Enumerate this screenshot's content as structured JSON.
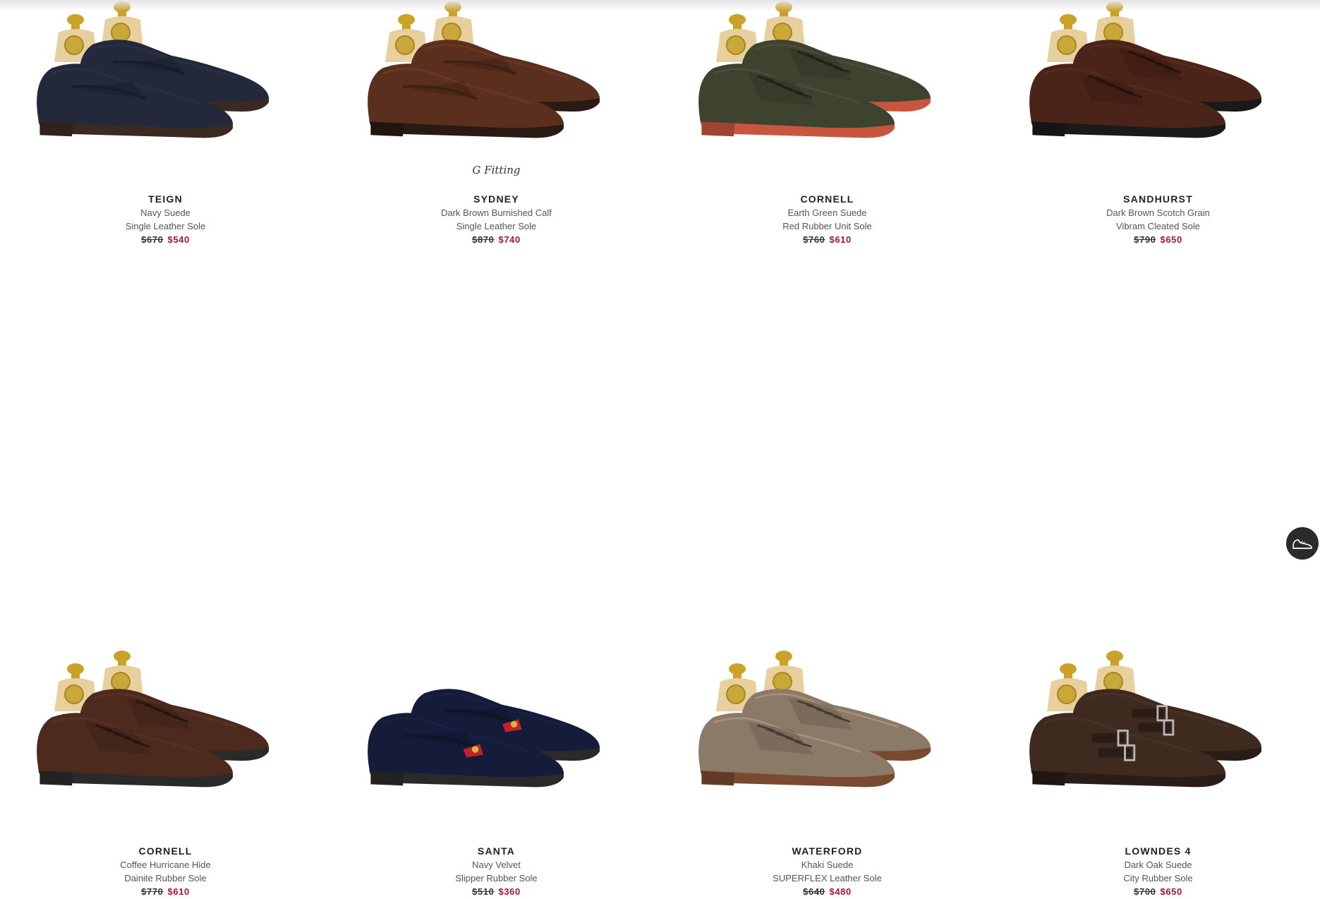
{
  "products": [
    {
      "name": "TEIGN",
      "material": "Navy Suede",
      "sole": "Single Leather Sole",
      "old_price": "$670",
      "new_price": "$540",
      "color": "#23283a",
      "sole_color": "#3b2a22",
      "style": "loafer"
    },
    {
      "name": "SYDNEY",
      "material": "Dark Brown Burnished Calf",
      "sole": "Single Leather Sole",
      "old_price": "$870",
      "new_price": "$740",
      "color": "#5a2f1e",
      "sole_color": "#2a1a14",
      "style": "loafer",
      "fitting": "G Fitting"
    },
    {
      "name": "CORNELL",
      "material": "Earth Green Suede",
      "sole": "Red Rubber Unit Sole",
      "old_price": "$760",
      "new_price": "$610",
      "color": "#3e4330",
      "sole_color": "#c8553d",
      "style": "derby"
    },
    {
      "name": "SANDHURST",
      "material": "Dark Brown Scotch Grain",
      "sole": "Vibram Cleated Sole",
      "old_price": "$790",
      "new_price": "$650",
      "color": "#4a2418",
      "sole_color": "#1a1a1a",
      "style": "derby"
    },
    {
      "name": "CORNELL",
      "material": "Coffee Hurricane Hide",
      "sole": "Dainite Rubber Sole",
      "old_price": "$770",
      "new_price": "$610",
      "color": "#4d2a1e",
      "sole_color": "#2a2a2a",
      "style": "derby"
    },
    {
      "name": "SANTA",
      "material": "Navy Velvet",
      "sole": "Slipper Rubber Sole",
      "old_price": "$510",
      "new_price": "$360",
      "color": "#141c3a",
      "sole_color": "#2a2a2a",
      "style": "slipper"
    },
    {
      "name": "WATERFORD",
      "material": "Khaki Suede",
      "sole": "SUPERFLEX Leather Sole",
      "old_price": "$640",
      "new_price": "$480",
      "color": "#8c7a68",
      "sole_color": "#7a4a30",
      "style": "derby"
    },
    {
      "name": "LOWNDES 4",
      "material": "Dark Oak Suede",
      "sole": "City Rubber Sole",
      "old_price": "$700",
      "new_price": "$650",
      "color": "#3e2a1e",
      "sole_color": "#2a1c16",
      "style": "monk"
    }
  ],
  "floating_button": {
    "icon": "shoe-icon",
    "bg": "#2b2b2b"
  },
  "colors": {
    "sale": "#b0113c",
    "tree": "#e8cf9e",
    "brass": "#c9a227"
  }
}
